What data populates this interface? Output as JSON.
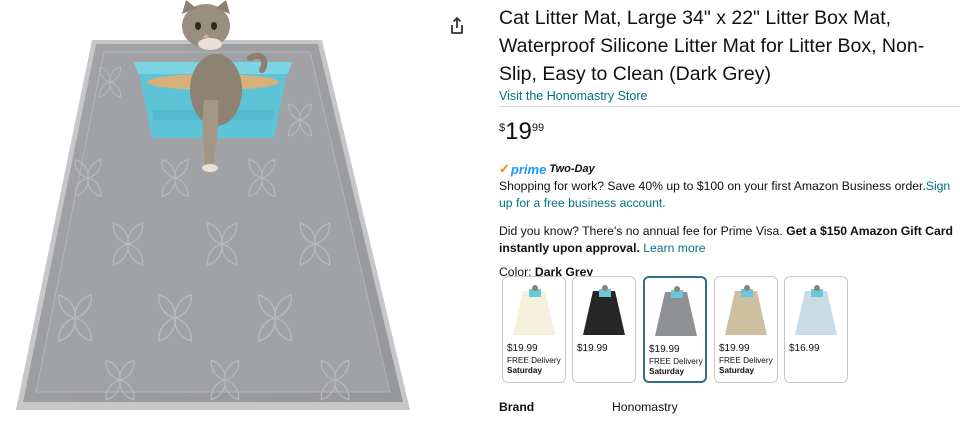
{
  "product": {
    "title": "Cat Litter Mat, Large 34\" x 22\" Litter Box Mat, Waterproof Silicone Litter Mat for Litter Box, Non-Slip, Easy to Clean (Dark Grey)",
    "store_link": "Visit the Honomastry Store",
    "price": {
      "currency": "$",
      "whole": "19",
      "fraction": "99"
    },
    "prime": {
      "check": "✓",
      "word": "prime",
      "tag": "Two-Day"
    },
    "promo": {
      "text": "Shopping for work? Save 40% up to $100 on your first Amazon Business order.",
      "link": "Sign up for a free business account."
    },
    "visa": {
      "text": "Did you know? There's no annual fee for Prime Visa. ",
      "bold": "Get a $150 Amazon Gift Card instantly upon approval.",
      "link": "Learn more"
    },
    "color": {
      "label": "Color:",
      "value": "Dark Grey"
    },
    "swatches": [
      {
        "price": "$19.99",
        "delivery": "FREE Delivery",
        "day": "Saturday",
        "mat_color": "#f3f0dc",
        "selected": false
      },
      {
        "price": "$19.99",
        "delivery": "",
        "day": "",
        "mat_color": "#262626",
        "selected": false
      },
      {
        "price": "$19.99",
        "delivery": "FREE Delivery",
        "day": "Saturday",
        "mat_color": "#8f9093",
        "selected": true
      },
      {
        "price": "$19.99",
        "delivery": "FREE Delivery",
        "day": "Saturday",
        "mat_color": "#cdbf9f",
        "selected": false
      },
      {
        "price": "$16.99",
        "delivery": "",
        "day": "",
        "mat_color": "#c9dbe4",
        "selected": false
      }
    ],
    "brand": {
      "label": "Brand",
      "value": "Honomastry"
    }
  },
  "icons": {
    "share": "share-icon"
  },
  "colors": {
    "link": "#007185",
    "prime_blue": "#1a98ff",
    "prime_check": "#f08804",
    "selected_border": "#2f6f8a",
    "mat_grey": "#9c9da0"
  }
}
